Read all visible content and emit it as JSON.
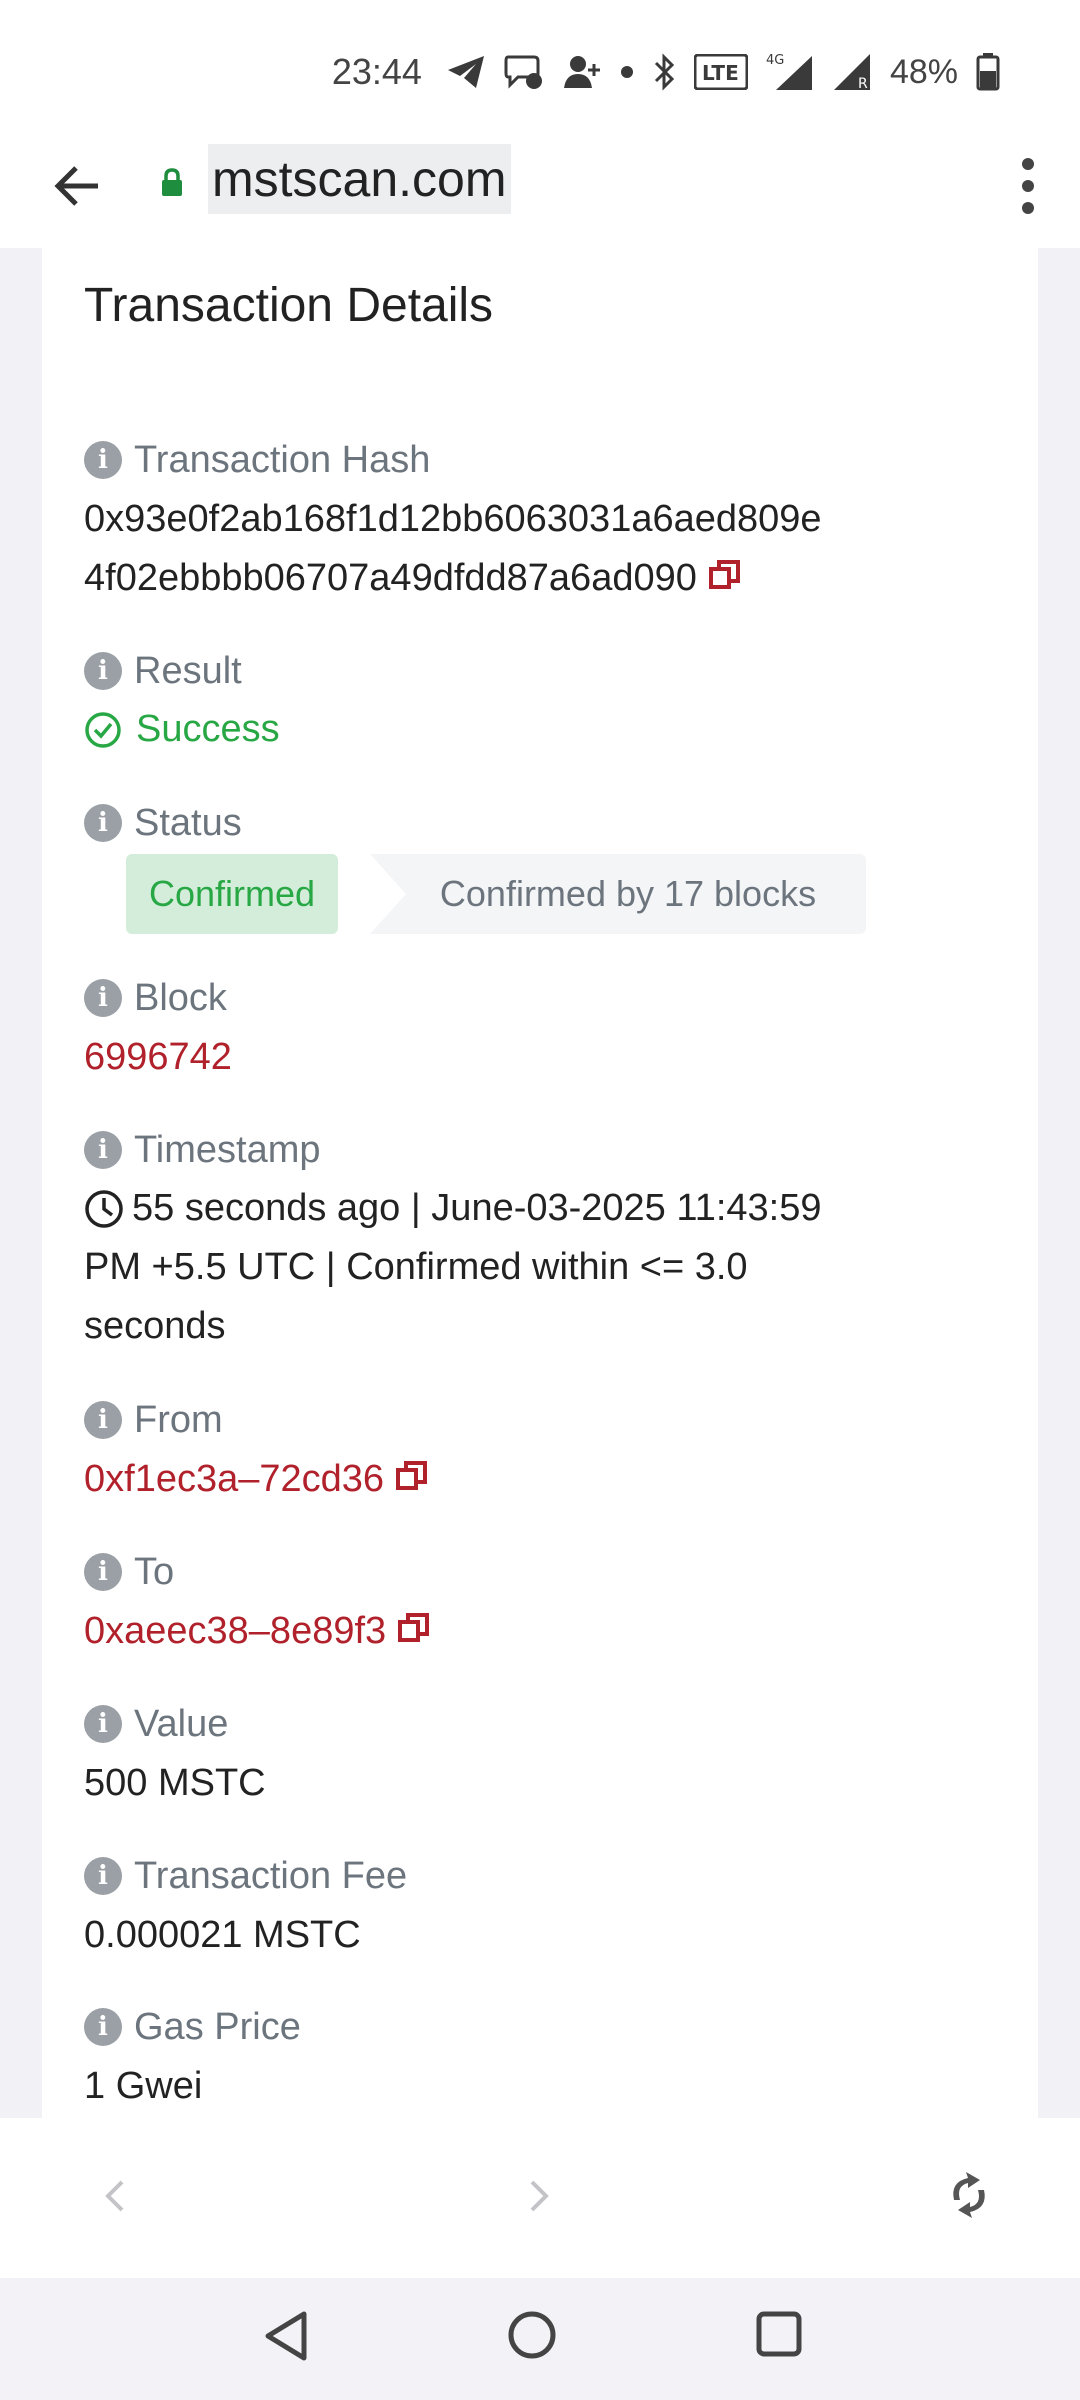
{
  "status_bar": {
    "time": "23:44",
    "battery": "48%",
    "network": "4G",
    "icons": [
      "telegram-icon",
      "chat-icon",
      "add-contact-icon",
      "dot-icon",
      "bluetooth-icon",
      "volte-icon",
      "signal-icon",
      "roaming-signal-icon",
      "battery-icon"
    ]
  },
  "browser": {
    "url": "mstscan.com"
  },
  "page": {
    "title": "Transaction Details",
    "fields": {
      "hash": {
        "label": "Transaction Hash",
        "value_line1": "0x93e0f2ab168f1d12bb6063031a6aed809e",
        "value_line2": "4f02ebbbb06707a49dfdd87a6ad090"
      },
      "result": {
        "label": "Result",
        "value": "Success"
      },
      "status": {
        "label": "Status",
        "badge": "Confirmed",
        "blocks": "Confirmed by 17 blocks"
      },
      "block": {
        "label": "Block",
        "value": "6996742"
      },
      "timestamp": {
        "label": "Timestamp",
        "line1": "55 seconds ago | June-03-2025 11:43:59",
        "line2": "PM +5.5 UTC | Confirmed within <= 3.0",
        "line3": "seconds"
      },
      "from": {
        "label": "From",
        "value": "0xf1ec3a–72cd36"
      },
      "to": {
        "label": "To",
        "value": "0xaeec38–8e89f3"
      },
      "value": {
        "label": "Value",
        "value": "500 MSTC"
      },
      "fee": {
        "label": "Transaction Fee",
        "value": "0.000021 MSTC"
      },
      "gas": {
        "label": "Gas Price",
        "value": "1 Gwei"
      }
    }
  },
  "colors": {
    "link_red": "#b1212b",
    "success_green": "#28a745",
    "badge_green_bg": "#d4edda",
    "label_gray": "#6c757d"
  }
}
